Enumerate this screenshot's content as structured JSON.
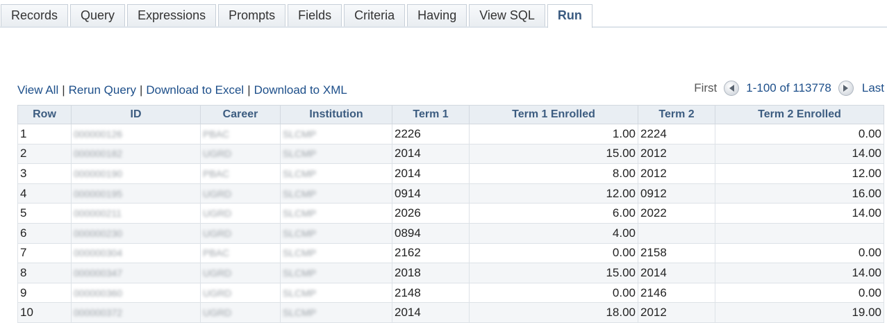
{
  "tabs": [
    {
      "label": "Records"
    },
    {
      "label": "Query"
    },
    {
      "label": "Expressions"
    },
    {
      "label": "Prompts"
    },
    {
      "label": "Fields"
    },
    {
      "label": "Criteria"
    },
    {
      "label": "Having"
    },
    {
      "label": "View SQL"
    },
    {
      "label": "Run",
      "active": true
    }
  ],
  "actions": {
    "view_all": "View All",
    "rerun_query": "Rerun Query",
    "download_excel": "Download to Excel",
    "download_xml": "Download to XML",
    "separator": "|"
  },
  "pager": {
    "first": "First",
    "range": "1-100 of 113778",
    "last": "Last",
    "prev_icon": "chevron-left-icon",
    "next_icon": "chevron-right-icon"
  },
  "table": {
    "columns": [
      "Row",
      "ID",
      "Career",
      "Institution",
      "Term 1",
      "Term 1 Enrolled",
      "Term 2",
      "Term 2 Enrolled"
    ],
    "rows": [
      {
        "row": "1",
        "id": "000000126",
        "career": "PBAC",
        "institution": "SLCMP",
        "term1": "2226",
        "term1_enrolled": "1.00",
        "term2": "2224",
        "term2_enrolled": "0.00"
      },
      {
        "row": "2",
        "id": "000000182",
        "career": "UGRD",
        "institution": "SLCMP",
        "term1": "2014",
        "term1_enrolled": "15.00",
        "term2": "2012",
        "term2_enrolled": "14.00"
      },
      {
        "row": "3",
        "id": "000000190",
        "career": "PBAC",
        "institution": "SLCMP",
        "term1": "2014",
        "term1_enrolled": "8.00",
        "term2": "2012",
        "term2_enrolled": "12.00"
      },
      {
        "row": "4",
        "id": "000000195",
        "career": "UGRD",
        "institution": "SLCMP",
        "term1": "0914",
        "term1_enrolled": "12.00",
        "term2": "0912",
        "term2_enrolled": "16.00"
      },
      {
        "row": "5",
        "id": "000000211",
        "career": "UGRD",
        "institution": "SLCMP",
        "term1": "2026",
        "term1_enrolled": "6.00",
        "term2": "2022",
        "term2_enrolled": "14.00"
      },
      {
        "row": "6",
        "id": "000000230",
        "career": "UGRD",
        "institution": "SLCMP",
        "term1": "0894",
        "term1_enrolled": "4.00",
        "term2": "",
        "term2_enrolled": ""
      },
      {
        "row": "7",
        "id": "000000304",
        "career": "PBAC",
        "institution": "SLCMP",
        "term1": "2162",
        "term1_enrolled": "0.00",
        "term2": "2158",
        "term2_enrolled": "0.00"
      },
      {
        "row": "8",
        "id": "000000347",
        "career": "UGRD",
        "institution": "SLCMP",
        "term1": "2018",
        "term1_enrolled": "15.00",
        "term2": "2014",
        "term2_enrolled": "14.00"
      },
      {
        "row": "9",
        "id": "000000360",
        "career": "UGRD",
        "institution": "SLCMP",
        "term1": "2148",
        "term1_enrolled": "0.00",
        "term2": "2146",
        "term2_enrolled": "0.00"
      },
      {
        "row": "10",
        "id": "000000372",
        "career": "UGRD",
        "institution": "SLCMP",
        "term1": "2014",
        "term1_enrolled": "18.00",
        "term2": "2012",
        "term2_enrolled": "19.00"
      }
    ]
  }
}
